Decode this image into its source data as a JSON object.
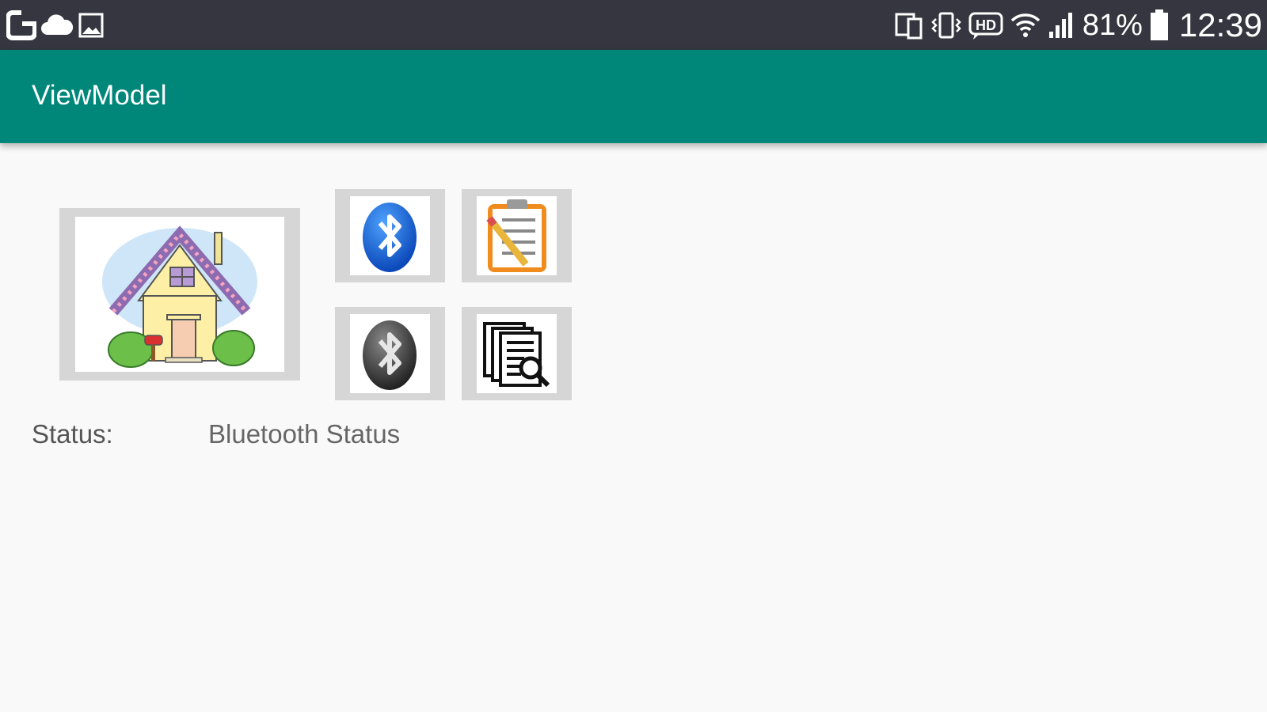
{
  "status_bar": {
    "icons_left": [
      "g-app-icon",
      "cloud-icon",
      "image-icon"
    ],
    "icons_right": [
      "device-screen-icon",
      "vibrate-icon",
      "hd-voice-icon",
      "wifi-icon",
      "signal-icon",
      "battery-icon"
    ],
    "hd_text": "HD",
    "battery_percent": "81%",
    "time": "12:39"
  },
  "toolbar": {
    "title": "ViewModel",
    "color": "#00877a"
  },
  "buttons": {
    "home": {
      "icon": "house-icon"
    },
    "bluetooth_on": {
      "icon": "bluetooth-on-icon",
      "color": "#1a6fe0"
    },
    "bluetooth_off": {
      "icon": "bluetooth-off-icon",
      "color": "#3a3a3a"
    },
    "clipboard": {
      "icon": "clipboard-icon"
    },
    "documents_search": {
      "icon": "documents-search-icon"
    }
  },
  "status": {
    "label": "Status:",
    "value": "Bluetooth Status"
  }
}
